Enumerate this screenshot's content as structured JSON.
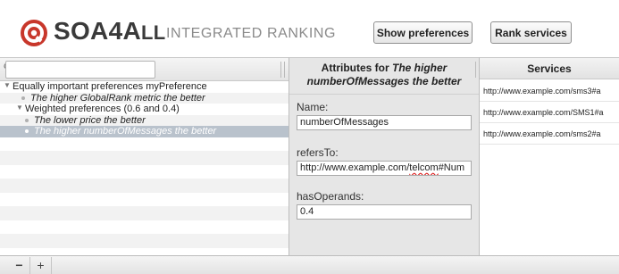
{
  "header": {
    "logo_icon": "soa4all-logo-icon",
    "brand_main": "SOA4A",
    "brand_small": "LL",
    "brand_sub": "INTEGRATED RANKING",
    "show_preferences_label": "Show preferences",
    "rank_services_label": "Rank services",
    "accent_color": "#c8372b"
  },
  "search": {
    "value": "",
    "placeholder": "",
    "icon": "search-icon"
  },
  "tree": {
    "items": [
      {
        "label": "Equally important preferences myPreference",
        "level": 0,
        "expander": "expanded"
      },
      {
        "label": "The higher GlobalRank metric the better",
        "level": 1,
        "expander": "leaf"
      },
      {
        "label": "Weighted preferences (0.6 and 0.4)",
        "level": 1,
        "expander": "expanded"
      },
      {
        "label": "The lower price the better",
        "level": 2,
        "expander": "leaf"
      },
      {
        "label": "The higher numberOfMessages the better",
        "level": 2,
        "expander": "leaf",
        "selected": true
      }
    ]
  },
  "attributes": {
    "title_prefix": "Attributes for",
    "title_line1_italic": "The higher",
    "title_line2_italic": "numberOfMessages the better",
    "name_label": "Name:",
    "name_value": "numberOfMessages",
    "refers_label": "refersTo:",
    "refers_value_a": "http://www.example.com/",
    "refers_value_b": "telcom",
    "refers_value_c": "#Num",
    "operands_label": "hasOperands:",
    "operands_value": "0.4"
  },
  "services": {
    "header": "Services",
    "rows": [
      "http://www.example.com/sms3#a",
      "http://www.example.com/SMS1#a",
      "http://www.example.com/sms2#a"
    ]
  },
  "footer": {
    "remove_label": "−",
    "add_label": "+"
  }
}
